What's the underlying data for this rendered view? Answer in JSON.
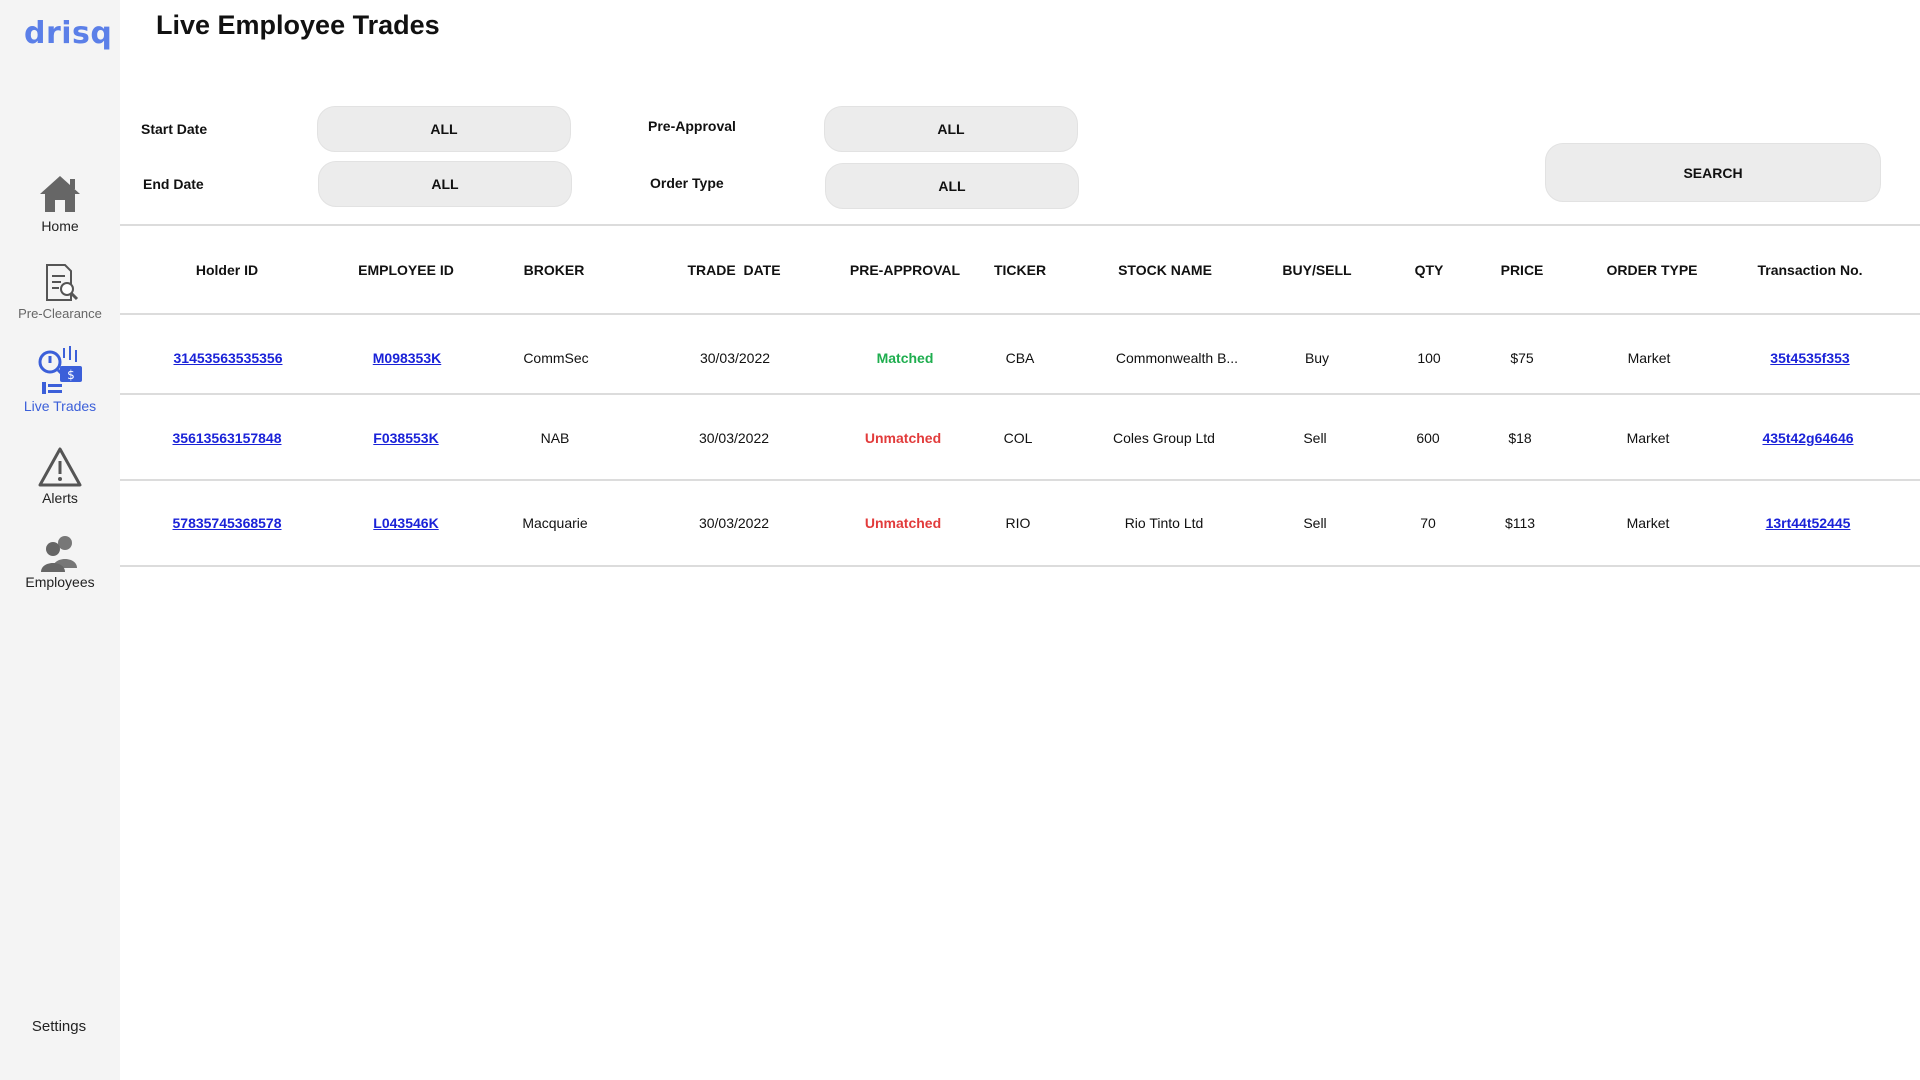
{
  "app": {
    "logo": "drisq"
  },
  "sidebar": {
    "items": [
      {
        "label": "Home",
        "icon": "home-icon"
      },
      {
        "label": "Pre-Clearance",
        "icon": "document-search-icon"
      },
      {
        "label": "Live Trades",
        "icon": "live-trades-icon"
      },
      {
        "label": "Alerts",
        "icon": "alert-icon"
      },
      {
        "label": "Employees",
        "icon": "employees-icon"
      }
    ],
    "settings_label": "Settings",
    "active": "Live Trades"
  },
  "page": {
    "title": "Live Employee Trades"
  },
  "filters": {
    "start_date": {
      "label": "Start Date",
      "value": "ALL"
    },
    "end_date": {
      "label": "End Date",
      "value": "ALL"
    },
    "pre_approval": {
      "label": "Pre-Approval",
      "value": "ALL"
    },
    "order_type": {
      "label": "Order Type",
      "value": "ALL"
    },
    "search_label": "SEARCH"
  },
  "table": {
    "headers": [
      "Holder ID",
      "EMPLOYEE ID",
      "BROKER",
      "TRADE  DATE",
      "PRE-APPROVAL",
      "TICKER",
      "STOCK NAME",
      "BUY/SELL",
      "QTY",
      "PRICE",
      "ORDER TYPE",
      "Transaction No."
    ],
    "rows": [
      [
        "31453563535356",
        "M098353K",
        "CommSec",
        "30/03/2022",
        "Matched",
        "CBA",
        "Commonwealth B...",
        "Buy",
        "100",
        "$75",
        "Market",
        "35t4535f353"
      ],
      [
        "35613563157848",
        "F038553K",
        "NAB",
        "30/03/2022",
        "Unmatched",
        "COL",
        "Coles Group Ltd",
        "Sell",
        "600",
        "$18",
        "Market",
        "435t42g64646"
      ],
      [
        "57835745368578",
        "L043546K",
        "Macquarie",
        "30/03/2022",
        "Unmatched",
        "RIO",
        "Rio Tinto Ltd",
        "Sell",
        "70",
        "$113",
        "Market",
        "13rt44t52445"
      ]
    ]
  },
  "colors": {
    "accent": "#3b5fd9",
    "matched": "#1fae4f",
    "unmatched": "#e23b3b",
    "link": "#1a22d8"
  }
}
